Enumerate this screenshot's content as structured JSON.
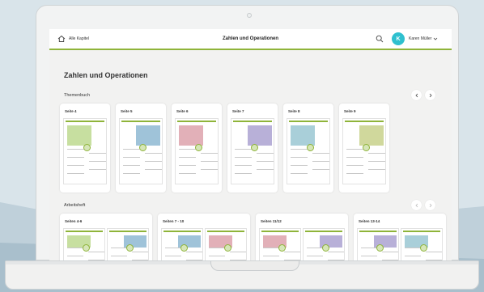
{
  "app": {
    "back_label": "Alle Kapitel",
    "title": "Zahlen und Operationen",
    "user_initial": "K",
    "user_name": "Karen Müller"
  },
  "page": {
    "title": "Zahlen und Operationen"
  },
  "themenbuch": {
    "label": "Themenbuch",
    "pages": [
      "Seite 4",
      "Seite 5",
      "Seite 6",
      "Seite 7",
      "Seite 8",
      "Seite 9"
    ]
  },
  "arbeitsheft": {
    "label": "Arbeitsheft",
    "pages": [
      "Seiten 4-6",
      "Seiten 7 - 10",
      "Seiten 11/12",
      "Seiten 13-14"
    ]
  },
  "colors": {
    "accent": "#8fb43a",
    "avatar": "#2fc0cf"
  }
}
